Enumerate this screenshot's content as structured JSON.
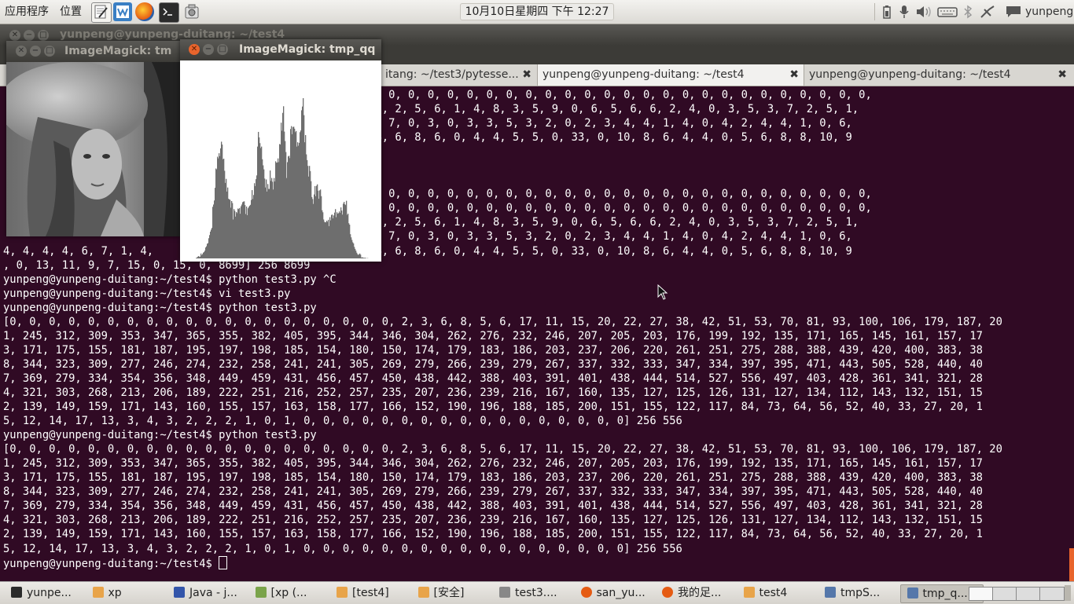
{
  "top_panel": {
    "menu_apps": "应用程序",
    "menu_places": "位置",
    "clock": "10月10日星期四 下午 12:27",
    "user": "yunpeng"
  },
  "back_window": {
    "title": "yunpeng@yunpeng-duitang: ~/test4"
  },
  "image_window_1": {
    "title": "ImageMagick: tm"
  },
  "image_window_2": {
    "title": "ImageMagick: tmp_qq"
  },
  "terminal": {
    "tabs": [
      {
        "label": "itang: ~/test3/pytesse..."
      },
      {
        "label": "yunpeng@yunpeng-duitang: ~/test4"
      },
      {
        "label": "yunpeng@yunpeng-duitang: ~/test4"
      }
    ],
    "close_glyph": "✖",
    "lines": [
      "                                   0, 0, 0, 0, 0, 0, 0, 0, 0, 0, 0, 0, 0, 0, 0, 0, 0, 0, 0, 0, 0, 0, 0, 0, 0, 0, 0, 0, 0, 0, 0, 0, 0,",
      "                                   3, 10, 4, 6, 0, 8, 6, 8, 2, 5, 6, 1, 4, 8, 3, 5, 9, 0, 6, 5, 6, 6, 2, 4, 0, 3, 5, 3, 7, 2, 5, 1,",
      "                                   9, 4, 9, 5, 0, 2, 4, 5, 7, 0, 3, 0, 3, 3, 5, 3, 2, 0, 2, 3, 4, 4, 1, 4, 0, 4, 2, 4, 4, 1, 0, 6,",
      "                                   6, 5, 2, 0, 10, 0, 4, 4, 6, 8, 6, 0, 4, 4, 5, 5, 0, 33, 0, 10, 8, 6, 4, 4, 0, 5, 6, 8, 8, 10, 9",
      "",
      "",
      "",
      "                                   0, 0, 0, 0, 0, 0, 0, 0, 0, 0, 0, 0, 0, 0, 0, 0, 0, 0, 0, 0, 0, 0, 0, 0, 0, 0, 0, 0, 0, 0, 0, 0, 0,",
      "                                   0, 0, 0, 0, 0, 0, 0, 0, 0, 0, 0, 0, 0, 0, 0, 0, 0, 0, 0, 0, 0, 0, 0, 0, 0, 0, 0, 0, 0, 0, 0, 0, 0,",
      "                                   3, 10, 4, 6, 0, 8, 6, 8, 2, 5, 6, 1, 4, 8, 3, 5, 9, 0, 6, 5, 6, 6, 2, 4, 0, 3, 5, 3, 7, 2, 5, 1,",
      "                                   9, 4, 9, 5, 0, 2, 4, 5, 7, 0, 3, 0, 3, 3, 5, 3, 2, 0, 2, 3, 4, 4, 1, 4, 0, 4, 2, 4, 4, 1, 0, 6,",
      "4, 4, 4, 4, 6, 7, 1, 4,            6, 5, 2, 0, 10, 0, 4, 4, 6, 8, 6, 0, 4, 4, 5, 5, 0, 33, 0, 10, 8, 6, 4, 4, 0, 5, 6, 8, 8, 10, 9",
      ", 0, 13, 11, 9, 7, 15, 0, 15, 0, 8699] 256 8699",
      "yunpeng@yunpeng-duitang:~/test4$ python test3.py ^C",
      "yunpeng@yunpeng-duitang:~/test4$ vi test3.py",
      "yunpeng@yunpeng-duitang:~/test4$ python test3.py",
      "[0, 0, 0, 0, 0, 0, 0, 0, 0, 0, 0, 0, 0, 0, 0, 0, 0, 0, 0, 0, 2, 3, 6, 8, 5, 6, 17, 11, 15, 20, 22, 27, 38, 42, 51, 53, 70, 81, 93, 100, 106, 179, 187, 20",
      "1, 245, 312, 309, 353, 347, 365, 355, 382, 405, 395, 344, 346, 304, 262, 276, 232, 246, 207, 205, 203, 176, 199, 192, 135, 171, 165, 145, 161, 157, 17",
      "3, 171, 175, 155, 181, 187, 195, 197, 198, 185, 154, 180, 150, 174, 179, 183, 186, 203, 237, 206, 220, 261, 251, 275, 288, 388, 439, 420, 400, 383, 38",
      "8, 344, 323, 309, 277, 246, 274, 232, 258, 241, 241, 305, 269, 279, 266, 239, 279, 267, 337, 332, 333, 347, 334, 397, 395, 471, 443, 505, 528, 440, 40",
      "7, 369, 279, 334, 354, 356, 348, 449, 459, 431, 456, 457, 450, 438, 442, 388, 403, 391, 401, 438, 444, 514, 527, 556, 497, 403, 428, 361, 341, 321, 28",
      "4, 321, 303, 268, 213, 206, 189, 222, 251, 216, 252, 257, 235, 207, 236, 239, 216, 167, 160, 135, 127, 125, 126, 131, 127, 134, 112, 143, 132, 151, 15",
      "2, 139, 149, 159, 171, 143, 160, 155, 157, 163, 158, 177, 166, 152, 190, 196, 188, 185, 200, 151, 155, 122, 117, 84, 73, 64, 56, 52, 40, 33, 27, 20, 1",
      "5, 12, 14, 17, 13, 3, 4, 3, 2, 2, 2, 1, 0, 1, 0, 0, 0, 0, 0, 0, 0, 0, 0, 0, 0, 0, 0, 0, 0, 0, 0] 256 556",
      "yunpeng@yunpeng-duitang:~/test4$ python test3.py",
      "[0, 0, 0, 0, 0, 0, 0, 0, 0, 0, 0, 0, 0, 0, 0, 0, 0, 0, 0, 0, 2, 3, 6, 8, 5, 6, 17, 11, 15, 20, 22, 27, 38, 42, 51, 53, 70, 81, 93, 100, 106, 179, 187, 20",
      "1, 245, 312, 309, 353, 347, 365, 355, 382, 405, 395, 344, 346, 304, 262, 276, 232, 246, 207, 205, 203, 176, 199, 192, 135, 171, 165, 145, 161, 157, 17",
      "3, 171, 175, 155, 181, 187, 195, 197, 198, 185, 154, 180, 150, 174, 179, 183, 186, 203, 237, 206, 220, 261, 251, 275, 288, 388, 439, 420, 400, 383, 38",
      "8, 344, 323, 309, 277, 246, 274, 232, 258, 241, 241, 305, 269, 279, 266, 239, 279, 267, 337, 332, 333, 347, 334, 397, 395, 471, 443, 505, 528, 440, 40",
      "7, 369, 279, 334, 354, 356, 348, 449, 459, 431, 456, 457, 450, 438, 442, 388, 403, 391, 401, 438, 444, 514, 527, 556, 497, 403, 428, 361, 341, 321, 28",
      "4, 321, 303, 268, 213, 206, 189, 222, 251, 216, 252, 257, 235, 207, 236, 239, 216, 167, 160, 135, 127, 125, 126, 131, 127, 134, 112, 143, 132, 151, 15",
      "2, 139, 149, 159, 171, 143, 160, 155, 157, 163, 158, 177, 166, 152, 190, 196, 188, 185, 200, 151, 155, 122, 117, 84, 73, 64, 56, 52, 40, 33, 27, 20, 1",
      "5, 12, 14, 17, 13, 3, 4, 3, 2, 2, 2, 1, 0, 1, 0, 0, 0, 0, 0, 0, 0, 0, 0, 0, 0, 0, 0, 0, 0, 0, 0] 256 556"
    ],
    "prompt": "yunpeng@yunpeng-duitang:~/test4$ "
  },
  "taskbar": {
    "items": [
      {
        "label": "yunpe...",
        "icon": "terminal-icon"
      },
      {
        "label": "xp",
        "icon": "folder-icon"
      },
      {
        "label": "Java - j...",
        "icon": "java-icon"
      },
      {
        "label": "[xp (...",
        "icon": "image-icon"
      },
      {
        "label": "[test4]",
        "icon": "folder-icon"
      },
      {
        "label": "[安全]",
        "icon": "folder-icon"
      },
      {
        "label": "test3....",
        "icon": "editor-icon"
      },
      {
        "label": "san_yu...",
        "icon": "firefox-icon"
      },
      {
        "label": "我的足...",
        "icon": "firefox-icon"
      },
      {
        "label": "test4",
        "icon": "folder-icon"
      },
      {
        "label": "tmpS...",
        "icon": "window-icon"
      },
      {
        "label": "tmp_q...",
        "icon": "window-icon"
      }
    ]
  },
  "colors": {
    "terminal_bg": "#300a24",
    "titlebar": "#3c3b37",
    "close_button": "#e8642c",
    "histogram": "#6e6e6e"
  }
}
